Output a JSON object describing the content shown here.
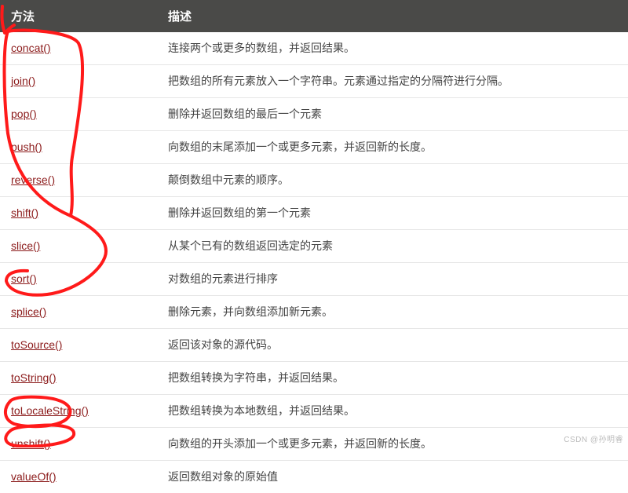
{
  "columns": {
    "method": "方法",
    "description": "描述"
  },
  "rows": [
    {
      "method": "concat()",
      "description": "连接两个或更多的数组，并返回结果。"
    },
    {
      "method": "join()",
      "description": "把数组的所有元素放入一个字符串。元素通过指定的分隔符进行分隔。"
    },
    {
      "method": "pop()",
      "description": "删除并返回数组的最后一个元素"
    },
    {
      "method": "push()",
      "description": "向数组的末尾添加一个或更多元素，并返回新的长度。"
    },
    {
      "method": "reverse()",
      "description": "颠倒数组中元素的顺序。"
    },
    {
      "method": "shift()",
      "description": "删除并返回数组的第一个元素"
    },
    {
      "method": "slice()",
      "description": "从某个已有的数组返回选定的元素"
    },
    {
      "method": "sort()",
      "description": "对数组的元素进行排序"
    },
    {
      "method": "splice()",
      "description": "删除元素，并向数组添加新元素。"
    },
    {
      "method": "toSource()",
      "description": "返回该对象的源代码。"
    },
    {
      "method": "toString()",
      "description": "把数组转换为字符串，并返回结果。"
    },
    {
      "method": "toLocaleString()",
      "description": "把数组转换为本地数组，并返回结果。"
    },
    {
      "method": "unshift()",
      "description": "向数组的开头添加一个或更多元素，并返回新的长度。"
    },
    {
      "method": "valueOf()",
      "description": "返回数组对象的原始值"
    }
  ],
  "watermark": "CSDN @孙明睿",
  "annotation_color": "#ff1a1a"
}
